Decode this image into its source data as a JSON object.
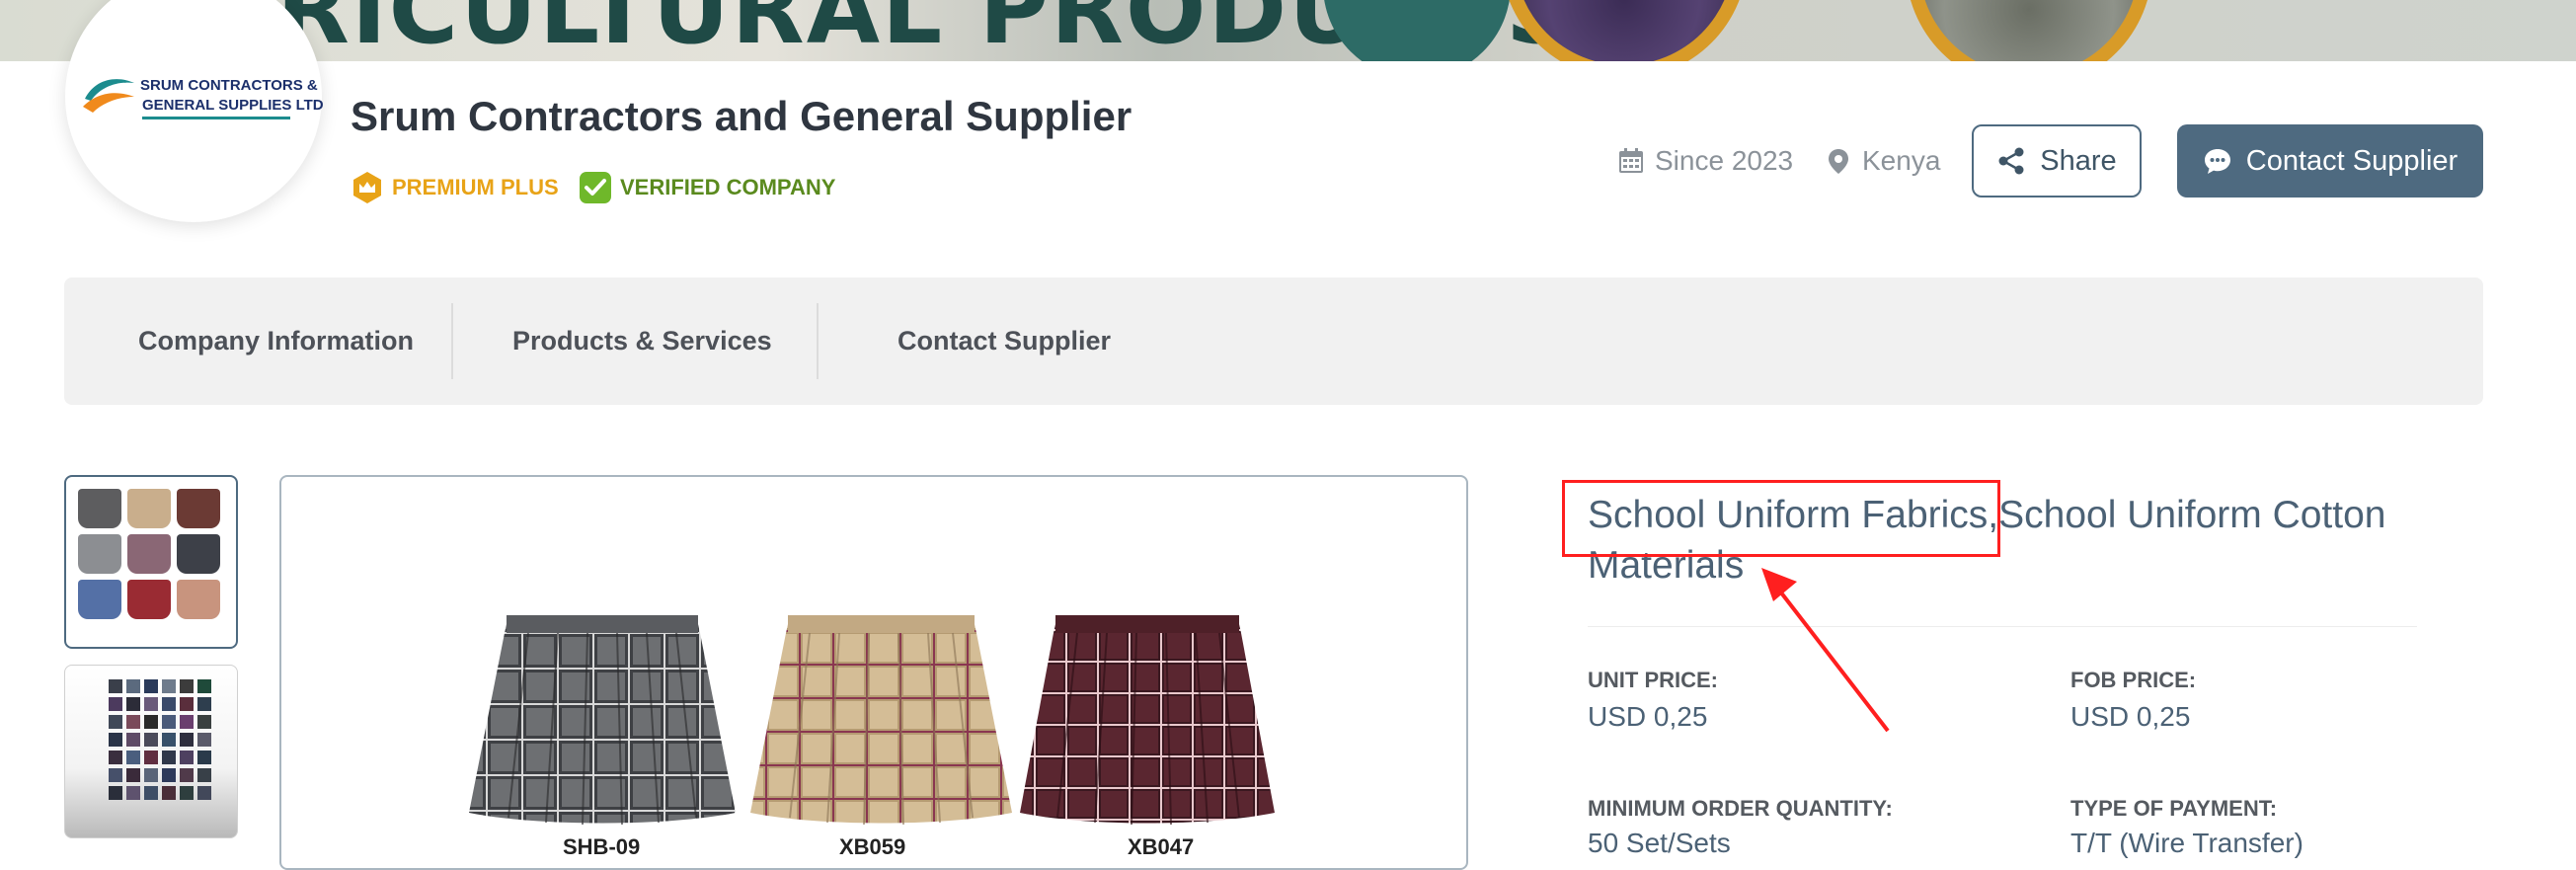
{
  "banner": {
    "text": "RICULTURAL PRODUCTS"
  },
  "logo": {
    "line1": "SRUM CONTRACTORS &",
    "line2": "GENERAL SUPPLIES LTD"
  },
  "header": {
    "company_name": "Srum Contractors and General Supplier",
    "badge_premium": "PREMIUM PLUS",
    "badge_verified": "VERIFIED COMPANY",
    "since": "Since 2023",
    "country": "Kenya",
    "share_label": "Share",
    "contact_label": "Contact Supplier"
  },
  "tabs": [
    {
      "label": "Company Information"
    },
    {
      "label": "Products & Services"
    },
    {
      "label": "Contact Supplier"
    }
  ],
  "product": {
    "title": "School Uniform Fabrics,School Uniform Cotton Materials",
    "image_labels": [
      "SHB-09",
      "XB059",
      "XB047"
    ],
    "specs": {
      "unit_price_label": "UNIT PRICE:",
      "unit_price": "USD 0,25",
      "fob_price_label": "FOB PRICE:",
      "fob_price": "USD 0,25",
      "moq_label": "MINIMUM ORDER QUANTITY:",
      "moq": "50 Set/Sets",
      "payment_label": "TYPE OF PAYMENT:",
      "payment": "T/T (Wire Transfer)"
    }
  },
  "colors": {
    "accent": "#4e6a80",
    "premium": "#e8a317",
    "verified": "#5a8a1e",
    "annotation": "#ff1f1f"
  },
  "icons": [
    "calendar-icon",
    "location-pin-icon",
    "share-icon",
    "chat-icon",
    "crown-shield-icon",
    "check-icon"
  ]
}
